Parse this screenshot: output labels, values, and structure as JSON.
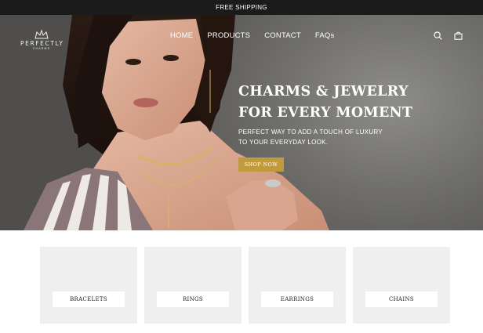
{
  "announcement": "FREE SHIPPING",
  "brand": {
    "name": "PERFECTLY",
    "tagline": "CHARMS"
  },
  "nav": {
    "items": [
      "HOME",
      "PRODUCTS",
      "CONTACT",
      "FAQs"
    ]
  },
  "header_icons": [
    "search-icon",
    "cart-icon"
  ],
  "hero": {
    "headline_line1": "CHARMS & JEWELRY",
    "headline_line2": "FOR EVERY MOMENT",
    "subtext_line1": "PERFECT WAY TO ADD A TOUCH OF LUXURY",
    "subtext_line2": "TO YOUR EVERYDAY LOOK.",
    "cta_label": "SHOP NOW"
  },
  "categories": [
    {
      "label": "BRACELETS"
    },
    {
      "label": "RINGS"
    },
    {
      "label": "EARRINGS"
    },
    {
      "label": "CHAINS"
    }
  ],
  "colors": {
    "announcement_bg": "#1b1b1b",
    "cta_bg": "#c29a3e",
    "card_bg": "#efefef"
  }
}
